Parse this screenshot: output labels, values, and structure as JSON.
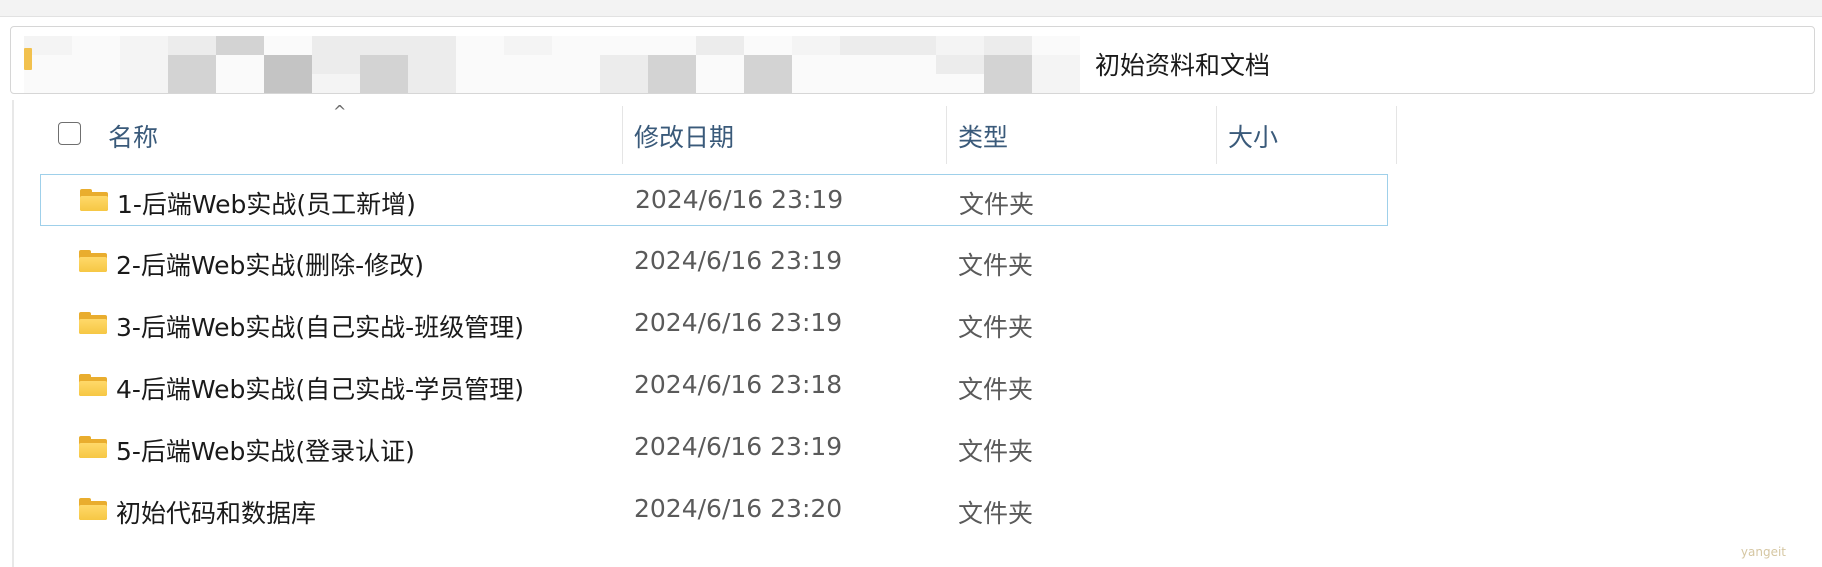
{
  "address_bar": {
    "current_folder": "初始资料和文档"
  },
  "columns": {
    "name": "名称",
    "date_modified": "修改日期",
    "type": "类型",
    "size": "大小"
  },
  "files": [
    {
      "name": "1-后端Web实战(员工新增)",
      "date": "2024/6/16 23:19",
      "type": "文件夹",
      "size": "",
      "selected": true
    },
    {
      "name": "2-后端Web实战(删除-修改)",
      "date": "2024/6/16 23:19",
      "type": "文件夹",
      "size": ""
    },
    {
      "name": "3-后端Web实战(自己实战-班级管理)",
      "date": "2024/6/16 23:19",
      "type": "文件夹",
      "size": ""
    },
    {
      "name": "4-后端Web实战(自己实战-学员管理)",
      "date": "2024/6/16 23:18",
      "type": "文件夹",
      "size": ""
    },
    {
      "name": "5-后端Web实战(登录认证)",
      "date": "2024/6/16 23:19",
      "type": "文件夹",
      "size": ""
    },
    {
      "name": "初始代码和数据库",
      "date": "2024/6/16 23:20",
      "type": "文件夹",
      "size": ""
    }
  ],
  "watermark": "yangeit",
  "colors": {
    "selection_border": "#9fd0ea",
    "header_text": "#3a5a7a",
    "folder_yellow": "#f6c744"
  },
  "icons": {
    "folder": "folder-icon",
    "sort_indicator": "chevron-up-icon"
  }
}
